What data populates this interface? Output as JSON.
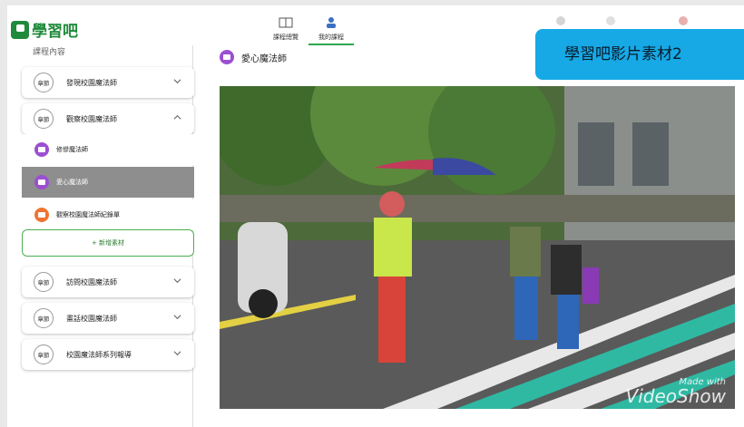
{
  "app": {
    "logo_text": "學習吧"
  },
  "topnav": [
    {
      "label": "課程總覽",
      "icon": "book-icon",
      "active": false
    },
    {
      "label": "我的課程",
      "icon": "teacher-icon",
      "active": true
    }
  ],
  "overlay_banner": "學習吧影片素材2",
  "sidebar": {
    "heading": "課程內容",
    "chapter_badge": "章節",
    "chapters_top": [
      {
        "label": "發現校園魔法師",
        "expanded": false
      },
      {
        "label": "觀察校園魔法師",
        "expanded": true
      }
    ],
    "lessons": [
      {
        "label": "修慘魔法師",
        "icon": "video-icon",
        "color": "#9b4fd1",
        "active": false
      },
      {
        "label": "愛心魔法師",
        "icon": "video-icon",
        "color": "#9b4fd1",
        "active": true
      },
      {
        "label": "觀察校園魔法師紀錄單",
        "icon": "document-icon",
        "color": "#f07430",
        "active": false
      }
    ],
    "add_material": "+ 新增素材",
    "chapters_bottom": [
      {
        "label": "訪問校園魔法師",
        "expanded": false
      },
      {
        "label": "畫話校園魔法師",
        "expanded": false
      },
      {
        "label": "校園魔法師系列報導",
        "expanded": false
      }
    ]
  },
  "main": {
    "title": "愛心魔法師",
    "watermark_small": "Made with",
    "watermark_large": "VideoShow"
  },
  "colors": {
    "brand": "#1f8a3b",
    "banner": "#16a9e6",
    "active_lesson": "#8e8e8e",
    "add_border": "#4caf50"
  }
}
